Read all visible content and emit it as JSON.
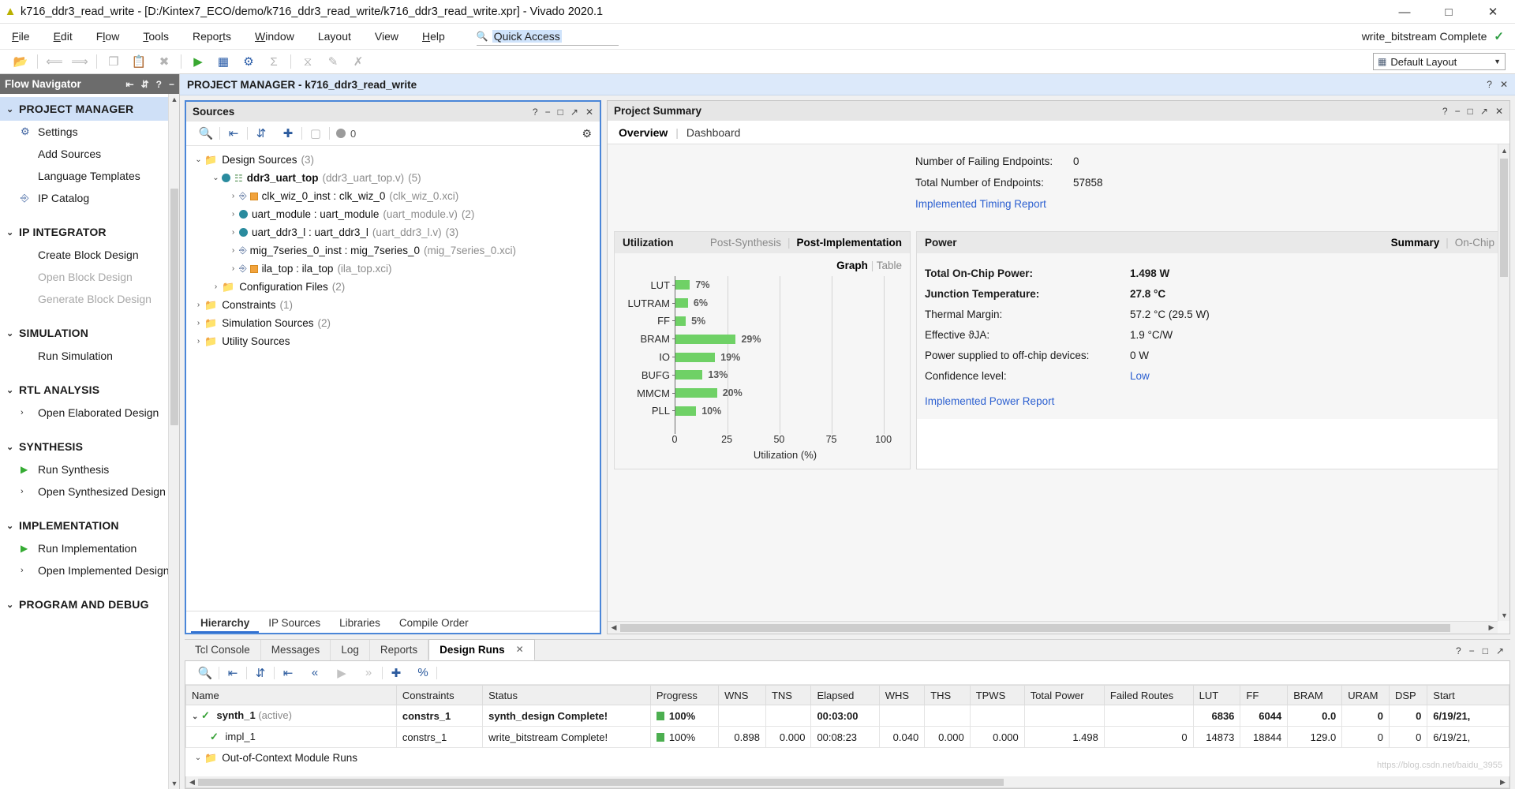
{
  "window": {
    "title": "k716_ddr3_read_write - [D:/Kintex7_ECO/demo/k716_ddr3_read_write/k716_ddr3_read_write.xpr] - Vivado 2020.1",
    "app_icon": "vivado-logo-icon",
    "minimize": "—",
    "maximize": "□",
    "close": "✕"
  },
  "menubar": {
    "items": [
      "File",
      "Edit",
      "Flow",
      "Tools",
      "Reports",
      "Window",
      "Layout",
      "View",
      "Help"
    ],
    "quick_access": {
      "icon": "search-icon",
      "text": "Quick Access",
      "placeholder": "Quick Access"
    },
    "status": {
      "text": "write_bitstream Complete",
      "check": "✓"
    }
  },
  "toolbar": {
    "buttons": [
      {
        "name": "open-project-icon",
        "glyph": "📂"
      },
      {
        "name": "undo-icon",
        "glyph": "↶"
      },
      {
        "name": "redo-icon",
        "glyph": "↷"
      },
      {
        "name": "copy-icon",
        "glyph": "❐"
      },
      {
        "name": "paste-icon",
        "glyph": "📋"
      },
      {
        "name": "delete-icon",
        "glyph": "✕"
      },
      {
        "name": "run-icon",
        "glyph": "▶"
      },
      {
        "name": "report-icon",
        "glyph": "❙❙❙"
      },
      {
        "name": "settings-icon",
        "glyph": "⚙"
      },
      {
        "name": "sum-icon",
        "glyph": "Σ"
      },
      {
        "name": "timing-icon",
        "glyph": "⧖"
      },
      {
        "name": "edit-icon",
        "glyph": "✎"
      },
      {
        "name": "marker-icon",
        "glyph": "✗"
      }
    ],
    "layout_select": {
      "icon": "layout-icon",
      "value": "Default Layout",
      "arrow": "▼"
    }
  },
  "flow_navigator": {
    "title": "Flow Navigator",
    "header_icons": [
      "collapse-all-icon",
      "expand-all-icon",
      "help-icon",
      "minimize-icon"
    ],
    "sections": [
      {
        "label": "PROJECT MANAGER",
        "active": true,
        "chevron": "⌄",
        "items": [
          {
            "label": "Settings",
            "icon": "gear-icon",
            "icon_glyph": "⚙",
            "disabled": false
          },
          {
            "label": "Add Sources",
            "icon": "none",
            "icon_glyph": "",
            "disabled": false
          },
          {
            "label": "Language Templates",
            "icon": "none",
            "icon_glyph": "",
            "disabled": false
          },
          {
            "label": "IP Catalog",
            "icon": "ip-catalog-icon",
            "icon_glyph": "⊕",
            "disabled": false
          }
        ]
      },
      {
        "label": "IP INTEGRATOR",
        "active": false,
        "chevron": "⌄",
        "items": [
          {
            "label": "Create Block Design",
            "icon": "none",
            "icon_glyph": "",
            "disabled": false
          },
          {
            "label": "Open Block Design",
            "icon": "none",
            "icon_glyph": "",
            "disabled": true
          },
          {
            "label": "Generate Block Design",
            "icon": "none",
            "icon_glyph": "",
            "disabled": true
          }
        ]
      },
      {
        "label": "SIMULATION",
        "active": false,
        "chevron": "⌄",
        "items": [
          {
            "label": "Run Simulation",
            "icon": "none",
            "icon_glyph": "",
            "disabled": false
          }
        ]
      },
      {
        "label": "RTL ANALYSIS",
        "active": false,
        "chevron": "⌄",
        "items": [
          {
            "label": "Open Elaborated Design",
            "icon": "chevron-right-icon",
            "icon_glyph": "›",
            "disabled": false
          }
        ]
      },
      {
        "label": "SYNTHESIS",
        "active": false,
        "chevron": "⌄",
        "items": [
          {
            "label": "Run Synthesis",
            "icon": "play-icon",
            "icon_glyph": "▶",
            "disabled": false
          },
          {
            "label": "Open Synthesized Design",
            "icon": "chevron-right-icon",
            "icon_glyph": "›",
            "disabled": false
          }
        ]
      },
      {
        "label": "IMPLEMENTATION",
        "active": false,
        "chevron": "⌄",
        "items": [
          {
            "label": "Run Implementation",
            "icon": "play-icon",
            "icon_glyph": "▶",
            "disabled": false
          },
          {
            "label": "Open Implemented Design",
            "icon": "chevron-right-icon",
            "icon_glyph": "›",
            "disabled": false
          }
        ]
      },
      {
        "label": "PROGRAM AND DEBUG",
        "active": false,
        "chevron": "⌄",
        "items": []
      }
    ]
  },
  "project_manager_bar": {
    "title": "PROJECT MANAGER - k716_ddr3_read_write",
    "icons": [
      "help-icon",
      "close-icon"
    ]
  },
  "sources_panel": {
    "title": "Sources",
    "header_icons": [
      "help-icon",
      "minimize-icon",
      "maximize-icon",
      "float-icon",
      "close-icon"
    ],
    "toolbar": [
      {
        "name": "search-icon",
        "glyph": "🔍"
      },
      {
        "name": "collapse-all-icon",
        "glyph": "⇟"
      },
      {
        "name": "expand-all-icon",
        "glyph": "⇳"
      },
      {
        "name": "add-sources-icon",
        "glyph": "✚"
      },
      {
        "name": "report-icon",
        "glyph": "▤"
      }
    ],
    "message_count": "0",
    "settings_icon": "gear-icon",
    "tree": [
      {
        "indent": 0,
        "chevron": "⌄",
        "icon": "folder-icon",
        "name": "Design Sources",
        "bold": false,
        "file": "",
        "count": "(3)"
      },
      {
        "indent": 1,
        "chevron": "⌄",
        "icon": "module-hier-icon",
        "name": "ddr3_uart_top",
        "bold": true,
        "file": "(ddr3_uart_top.v)",
        "count": "(5)"
      },
      {
        "indent": 2,
        "chevron": "›",
        "icon": "ip-orange-icon",
        "name": "clk_wiz_0_inst : clk_wiz_0",
        "bold": false,
        "file": "(clk_wiz_0.xci)",
        "count": ""
      },
      {
        "indent": 2,
        "chevron": "›",
        "icon": "module-icon",
        "name": "uart_module : uart_module",
        "bold": false,
        "file": "(uart_module.v)",
        "count": "(2)"
      },
      {
        "indent": 2,
        "chevron": "›",
        "icon": "module-icon",
        "name": "uart_ddr3_l : uart_ddr3_l",
        "bold": false,
        "file": "(uart_ddr3_l.v)",
        "count": "(3)"
      },
      {
        "indent": 2,
        "chevron": "›",
        "icon": "ip-icon",
        "name": "mig_7series_0_inst : mig_7series_0",
        "bold": false,
        "file": "(mig_7series_0.xci)",
        "count": ""
      },
      {
        "indent": 2,
        "chevron": "›",
        "icon": "ip-orange-icon",
        "name": "ila_top : ila_top",
        "bold": false,
        "file": "(ila_top.xci)",
        "count": ""
      },
      {
        "indent": 1,
        "chevron": "›",
        "icon": "folder-icon",
        "name": "Configuration Files",
        "bold": false,
        "file": "",
        "count": "(2)"
      },
      {
        "indent": 0,
        "chevron": "›",
        "icon": "folder-icon",
        "name": "Constraints",
        "bold": false,
        "file": "",
        "count": "(1)"
      },
      {
        "indent": 0,
        "chevron": "›",
        "icon": "folder-icon",
        "name": "Simulation Sources",
        "bold": false,
        "file": "",
        "count": "(2)"
      },
      {
        "indent": 0,
        "chevron": "›",
        "icon": "folder-icon",
        "name": "Utility Sources",
        "bold": false,
        "file": "",
        "count": ""
      }
    ],
    "tabs": [
      {
        "label": "Hierarchy",
        "selected": true
      },
      {
        "label": "IP Sources",
        "selected": false
      },
      {
        "label": "Libraries",
        "selected": false
      },
      {
        "label": "Compile Order",
        "selected": false
      }
    ]
  },
  "project_summary": {
    "title": "Project Summary",
    "header_icons": [
      "help-icon",
      "minimize-icon",
      "maximize-icon",
      "float-icon",
      "close-icon"
    ],
    "tabs": [
      {
        "label": "Overview",
        "selected": true
      },
      {
        "label": "Dashboard",
        "selected": false
      }
    ],
    "timing": [
      {
        "label": "Number of Failing Endpoints:",
        "value": "0"
      },
      {
        "label": "Total Number of Endpoints:",
        "value": "57858"
      }
    ],
    "timing_link": "Implemented Timing Report",
    "utilization_card": {
      "title": "Utilization",
      "modes": [
        {
          "label": "Post-Synthesis",
          "selected": false
        },
        {
          "label": "Post-Implementation",
          "selected": true
        }
      ],
      "views": [
        {
          "label": "Graph",
          "selected": true
        },
        {
          "label": "Table",
          "selected": false
        }
      ]
    },
    "power_card": {
      "title": "Power",
      "views": [
        {
          "label": "Summary",
          "selected": true
        },
        {
          "label": "On-Chip",
          "selected": false
        }
      ],
      "rows": [
        {
          "label": "Total On-Chip Power:",
          "value": "1.498 W",
          "bold": true
        },
        {
          "label": "Junction Temperature:",
          "value": "27.8 °C",
          "bold": true
        },
        {
          "label": "Thermal Margin:",
          "value": "57.2 °C (29.5 W)",
          "bold": false
        },
        {
          "label": "Effective ϑJA:",
          "value": "1.9 °C/W",
          "bold": false
        },
        {
          "label": "Power supplied to off-chip devices:",
          "value": "0 W",
          "bold": false
        },
        {
          "label": "Confidence level:",
          "value": "Low",
          "bold": false,
          "link": true
        }
      ],
      "link": "Implemented Power Report"
    }
  },
  "chart_data": {
    "type": "bar",
    "orientation": "horizontal",
    "title": "Utilization",
    "categories": [
      "LUT",
      "LUTRAM",
      "FF",
      "BRAM",
      "IO",
      "BUFG",
      "MMCM",
      "PLL"
    ],
    "values": [
      7,
      6,
      5,
      29,
      19,
      13,
      20,
      10
    ],
    "value_labels": [
      "7%",
      "6%",
      "5%",
      "29%",
      "19%",
      "13%",
      "20%",
      "10%"
    ],
    "xlabel": "Utilization (%)",
    "ylabel": "",
    "xlim": [
      0,
      110
    ],
    "xticks": [
      0,
      25,
      50,
      75,
      100
    ],
    "xtick_labels": [
      "0",
      "25",
      "50",
      "75",
      "100"
    ],
    "grid": true,
    "bar_color": "#6fd166",
    "legend": "none"
  },
  "bottom_dock": {
    "tabs": [
      {
        "label": "Tcl Console",
        "selected": false
      },
      {
        "label": "Messages",
        "selected": false
      },
      {
        "label": "Log",
        "selected": false
      },
      {
        "label": "Reports",
        "selected": false
      },
      {
        "label": "Design Runs",
        "selected": true,
        "close": "✕"
      }
    ],
    "header_icons": [
      "help-icon",
      "minimize-icon",
      "maximize-icon",
      "float-icon"
    ],
    "toolbar": [
      {
        "name": "search-icon",
        "glyph": "🔍"
      },
      {
        "name": "collapse-all-icon",
        "glyph": "⇟"
      },
      {
        "name": "expand-all-icon",
        "glyph": "⇳"
      },
      {
        "name": "first-icon",
        "glyph": "|◀"
      },
      {
        "name": "prev-icon",
        "glyph": "«"
      },
      {
        "name": "play-icon",
        "glyph": "▶"
      },
      {
        "name": "next-icon",
        "glyph": "»"
      },
      {
        "name": "add-icon",
        "glyph": "✚"
      },
      {
        "name": "percent-icon",
        "glyph": "%"
      }
    ],
    "columns": [
      "Name",
      "Constraints",
      "Status",
      "Progress",
      "WNS",
      "TNS",
      "Elapsed",
      "WHS",
      "THS",
      "TPWS",
      "Total Power",
      "Failed Routes",
      "LUT",
      "FF",
      "BRAM",
      "URAM",
      "DSP",
      "Start"
    ],
    "rows": [
      {
        "bold": true,
        "chevron": "⌄",
        "check": "✓",
        "name": "synth_1",
        "name_suffix": "(active)",
        "constraints": "constrs_1",
        "status": "synth_design Complete!",
        "progress": "100%",
        "wns": "",
        "tns": "",
        "elapsed": "00:03:00",
        "whs": "",
        "ths": "",
        "tpws": "",
        "total_power": "",
        "failed_routes": "",
        "lut": "6836",
        "ff": "6044",
        "bram": "0.0",
        "uram": "0",
        "dsp": "0",
        "start": "6/19/21,"
      },
      {
        "bold": false,
        "chevron": "",
        "check": "✓",
        "name": "impl_1",
        "name_suffix": "",
        "constraints": "constrs_1",
        "status": "write_bitstream Complete!",
        "progress": "100%",
        "wns": "0.898",
        "tns": "0.000",
        "elapsed": "00:08:23",
        "whs": "0.040",
        "ths": "0.000",
        "tpws": "0.000",
        "total_power": "1.498",
        "failed_routes": "0",
        "lut": "14873",
        "ff": "18844",
        "bram": "129.0",
        "uram": "0",
        "dsp": "0",
        "start": "6/19/21,"
      }
    ],
    "ooc_row": {
      "chevron": "⌄",
      "icon": "folder-icon",
      "label": "Out-of-Context Module Runs"
    }
  },
  "watermark": "https://blog.csdn.net/baidu_3955"
}
